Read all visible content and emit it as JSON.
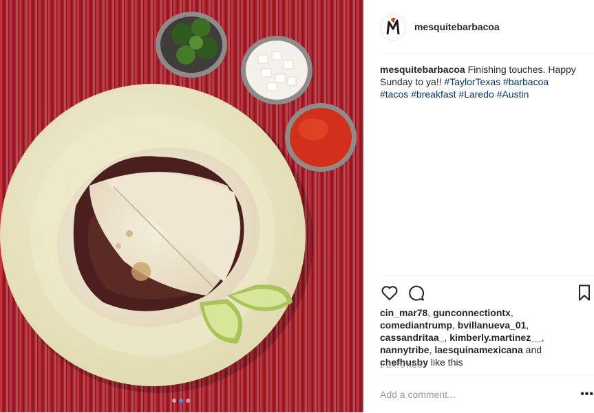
{
  "photo": {
    "alt_icon": "barbacoa-tacos-photo",
    "carousel_active_index": 1,
    "carousel_count": 3
  },
  "post": {
    "username": "mesquitebarbacoa",
    "avatar_icon": "mesquite-logo-icon",
    "caption_user": "mesquitebarbacoa",
    "caption_text": "Finishing touches. Happy Sunday to ya!!",
    "hashtags": [
      "#TaylorTexas",
      "#barbacoa",
      "#tacos",
      "#breakfast",
      "#Laredo",
      "#Austin"
    ]
  },
  "actions": {
    "like_icon": "heart-icon",
    "comment_icon": "comment-icon",
    "save_icon": "bookmark-icon"
  },
  "likes": {
    "users": [
      "cin_mar78",
      "gunconnectiontx",
      "comediantrump",
      "bvillanueva_01",
      "cassandritaa_",
      "kimberly.martinez__",
      "nannytribe",
      "laesquinamexicana"
    ],
    "and_text": "and",
    "last_user": "chefhusby",
    "suffix": "like this"
  },
  "timestamp": "2 DAYS AGO",
  "comment": {
    "placeholder": "Add a comment...",
    "more_label": "•••"
  },
  "colors": {
    "hashtag": "#003569",
    "tablecloth": "#b3262f",
    "plate": "#ede8c6",
    "salsa": "#d2301a",
    "lime": "#c8dc7a"
  }
}
